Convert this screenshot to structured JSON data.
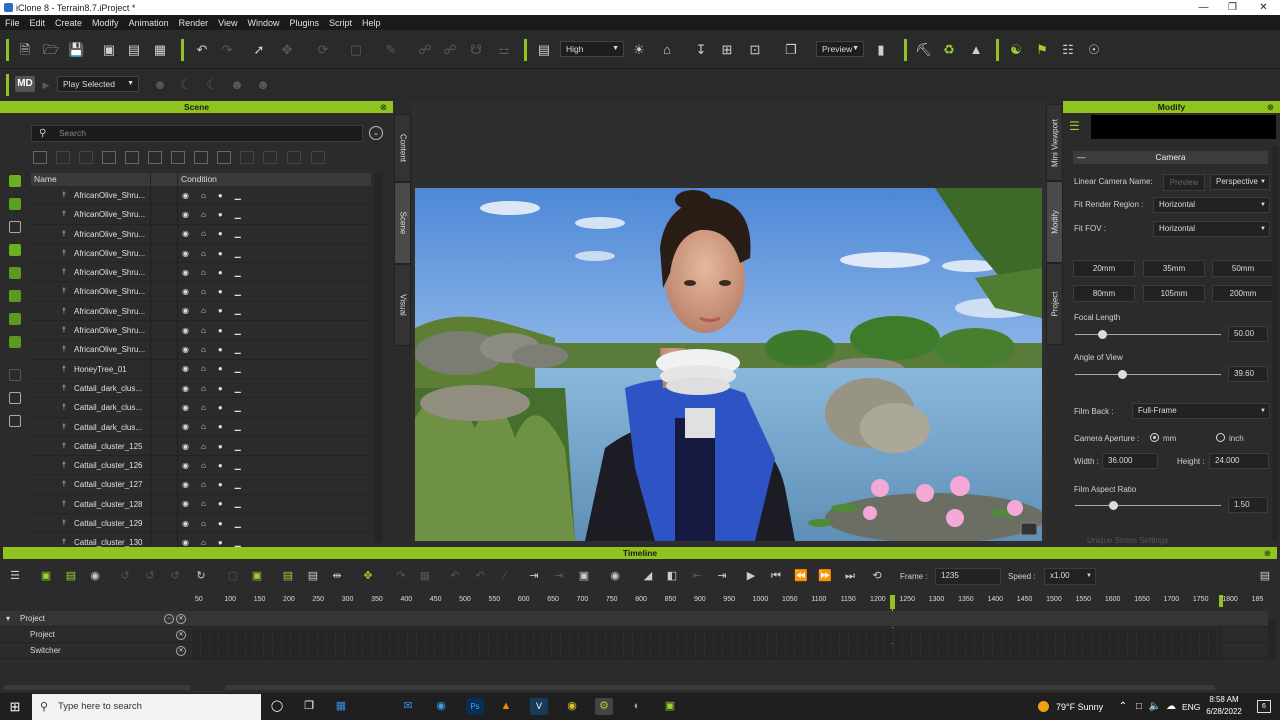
{
  "window": {
    "title": "iClone 8 - Terrain8.7.iProject *"
  },
  "menu": [
    "File",
    "Edit",
    "Create",
    "Modify",
    "Animation",
    "Render",
    "View",
    "Window",
    "Plugins",
    "Script",
    "Help"
  ],
  "toolbar": {
    "quality": "High",
    "preview": "Preview",
    "play_mode": "Play Selected",
    "md_logo": "MD"
  },
  "scene": {
    "header": "Scene",
    "search_placeholder": "Search",
    "columns": [
      "Name",
      "Condition"
    ],
    "rows": [
      "AfricanOlive_Shru...",
      "AfricanOlive_Shru...",
      "AfricanOlive_Shru...",
      "AfricanOlive_Shru...",
      "AfricanOlive_Shru...",
      "AfricanOlive_Shru...",
      "AfricanOlive_Shru...",
      "AfricanOlive_Shru...",
      "AfricanOlive_Shru...",
      "HoneyTree_01",
      "Cattail_dark_clus...",
      "Cattail_dark_clus...",
      "Cattail_dark_clus...",
      "Cattail_cluster_125",
      "Cattail_cluster_126",
      "Cattail_cluster_127",
      "Cattail_cluster_128",
      "Cattail_cluster_129",
      "Cattail_cluster_130"
    ]
  },
  "side_tabs": [
    "Content",
    "Scene",
    "Visual"
  ],
  "modify_tabs": [
    "Mini Viewport",
    "Modify",
    "Project"
  ],
  "modify": {
    "header": "Modify",
    "section": "Camera",
    "linear_camera_name_label": "Linear Camera Name:",
    "preview_btn": "Preview",
    "projection": "Perspective",
    "fit_render_region_label": "Fit Render Region :",
    "fit_render_region": "Horizontal",
    "fit_fov_label": "Fit FOV :",
    "fit_fov": "Horizontal",
    "lens_row1": [
      "20mm",
      "35mm",
      "50mm"
    ],
    "lens_row2": [
      "80mm",
      "105mm",
      "200mm"
    ],
    "focal_length_label": "Focal Length",
    "focal_length": "50.00",
    "angle_of_view_label": "Angle of View",
    "angle_of_view": "39.60",
    "film_back_label": "Film Back :",
    "film_back": "Full-Frame",
    "camera_aperture_label": "Camera Aperture :",
    "unit_mm": "mm",
    "unit_inch": "inch",
    "width_label": "Width :",
    "width": "36.000",
    "height_label": "Height :",
    "height": "24.000",
    "film_aspect_label": "Film Aspect Ratio",
    "film_aspect": "1.50",
    "cutoff_label": "Unique Stress Settings"
  },
  "timeline": {
    "header": "Timeline",
    "frame_label": "Frame :",
    "frame": "1235",
    "speed_label": "Speed :",
    "speed": "x1.00",
    "ruler": [
      "50",
      "100",
      "150",
      "200",
      "250",
      "300",
      "350",
      "400",
      "450",
      "500",
      "550",
      "600",
      "650",
      "700",
      "750",
      "800",
      "850",
      "900",
      "950",
      "1000",
      "1050",
      "1100",
      "1150",
      "1200",
      "1250",
      "1300",
      "1350",
      "1400",
      "1450",
      "1500",
      "1550",
      "1600",
      "1650",
      "1700",
      "1750",
      "1800",
      "185"
    ],
    "tracks": [
      "Project",
      "Project",
      "Switcher"
    ]
  },
  "taskbar": {
    "search_placeholder": "Type here to search",
    "weather": "79°F  Sunny",
    "lang": "ENG",
    "time": "8:58 AM",
    "date": "6/28/2022",
    "notif": "6"
  }
}
